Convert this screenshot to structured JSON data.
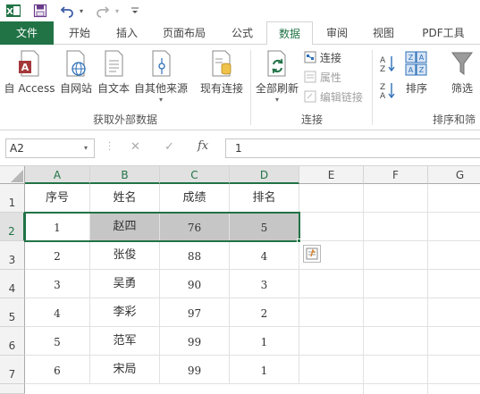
{
  "quick_access": {
    "excel_logo": "X",
    "save_icon": "save-icon",
    "undo_icon": "undo-icon",
    "redo_icon": "redo-icon",
    "customize_icon": "customize-icon"
  },
  "tabs": [
    "文件",
    "开始",
    "插入",
    "页面布局",
    "公式",
    "数据",
    "审阅",
    "视图",
    "PDF工具"
  ],
  "active_tab": "数据",
  "ribbon": {
    "get_external": {
      "access": "自 Access",
      "web": "自网站",
      "text": "自文本",
      "other": "自其他来源",
      "existing": "现有连接",
      "label": "获取外部数据"
    },
    "connections": {
      "refresh_all": "全部刷新",
      "connections": "连接",
      "properties": "属性",
      "edit_links": "编辑链接",
      "label": "连接"
    },
    "sort_filter": {
      "sort_az": "A↓Z",
      "sort_za": "Z↓A",
      "sort": "排序",
      "filter": "筛选",
      "label": "排序和筛"
    }
  },
  "formula_bar": {
    "name_box": "A2",
    "cancel": "✕",
    "enter": "✓",
    "fx": "fx",
    "value": "1"
  },
  "columns": [
    "A",
    "B",
    "C",
    "D",
    "E",
    "F",
    "G"
  ],
  "rows": [
    "1",
    "2",
    "3",
    "4",
    "5",
    "6",
    "7"
  ],
  "table": {
    "headers": [
      "序号",
      "姓名",
      "成绩",
      "排名"
    ],
    "data": [
      [
        "1",
        "赵四",
        "76",
        "5"
      ],
      [
        "2",
        "张俊",
        "88",
        "4"
      ],
      [
        "3",
        "吴勇",
        "90",
        "3"
      ],
      [
        "4",
        "李彩",
        "97",
        "2"
      ],
      [
        "5",
        "范军",
        "99",
        "1"
      ],
      [
        "6",
        "宋局",
        "99",
        "1"
      ]
    ]
  },
  "colors": {
    "brand_green": "#217346",
    "selection_fill": "#c6c6c6"
  }
}
